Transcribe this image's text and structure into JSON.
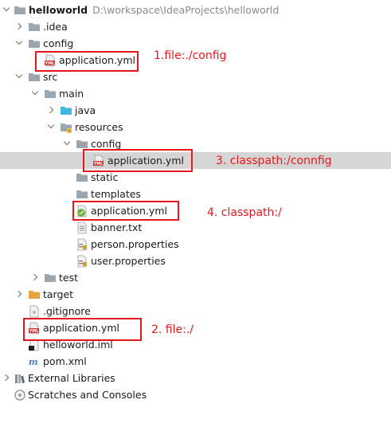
{
  "tree": {
    "root": {
      "name": "helloworld",
      "path": "D:\\workspace\\IdeaProjects\\helloworld"
    },
    "items": [
      {
        "label": ".idea"
      },
      {
        "label": "config"
      },
      {
        "label": "application.yml"
      },
      {
        "label": "src"
      },
      {
        "label": "main"
      },
      {
        "label": "java"
      },
      {
        "label": "resources"
      },
      {
        "label": "config"
      },
      {
        "label": "application.yml"
      },
      {
        "label": "static"
      },
      {
        "label": "templates"
      },
      {
        "label": "application.yml"
      },
      {
        "label": "banner.txt"
      },
      {
        "label": "person.properties"
      },
      {
        "label": "user.properties"
      },
      {
        "label": "test"
      },
      {
        "label": "target"
      },
      {
        "label": ".gitignore"
      },
      {
        "label": "application.yml"
      },
      {
        "label": "helloworld.iml"
      },
      {
        "label": "pom.xml"
      },
      {
        "label": "External Libraries"
      },
      {
        "label": "Scratches and Consoles"
      }
    ]
  },
  "annotations": [
    {
      "text": "1.file:./config"
    },
    {
      "text": "3. classpath:/connfig"
    },
    {
      "text": "4. classpath:/"
    },
    {
      "text": "2. file:./"
    }
  ],
  "icons": {
    "folder": "folder-icon",
    "folder-source": "source-folder-icon",
    "yml": "yml-file-icon",
    "spring-yml": "spring-yml-icon",
    "text": "text-file-icon",
    "properties": "properties-file-icon",
    "module": "module-icon",
    "maven": "maven-icon",
    "libraries": "libraries-icon",
    "scratches": "scratches-icon"
  },
  "colors": {
    "annotation": "#e8161b",
    "selection": "#d5d5d5",
    "folder": "#9aa7b0",
    "java_folder": "#40b6e0",
    "target_folder": "#e8a33d"
  }
}
